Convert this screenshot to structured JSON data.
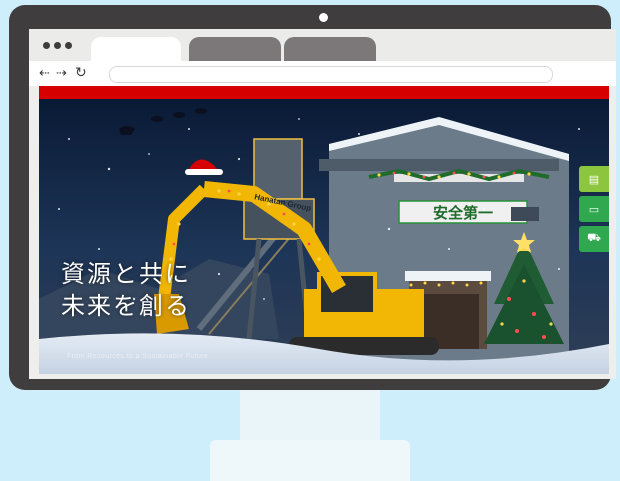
{
  "browser": {
    "icons": {
      "back": "back-arrow-icon",
      "forward": "forward-arrow-icon",
      "reload": "reload-icon"
    },
    "url_value": ""
  },
  "hero": {
    "headline_line1": "資源と共に",
    "headline_line2": "未来を創る",
    "subline": "From Resources to a Sustainable Future"
  },
  "scene": {
    "wall_sign": "安全第一",
    "machine_brand": "Hanatan Group"
  },
  "side_buttons": [
    {
      "icon": "building-icon",
      "color": "#8cc63f"
    },
    {
      "icon": "monitor-icon",
      "color": "#2fa84f"
    },
    {
      "icon": "truck-icon",
      "color": "#2fa84f"
    }
  ],
  "colors": {
    "background": "#cfeefb",
    "bezel": "#3f3d3e",
    "brand_red": "#d60000",
    "machine_yellow": "#f2b705"
  }
}
